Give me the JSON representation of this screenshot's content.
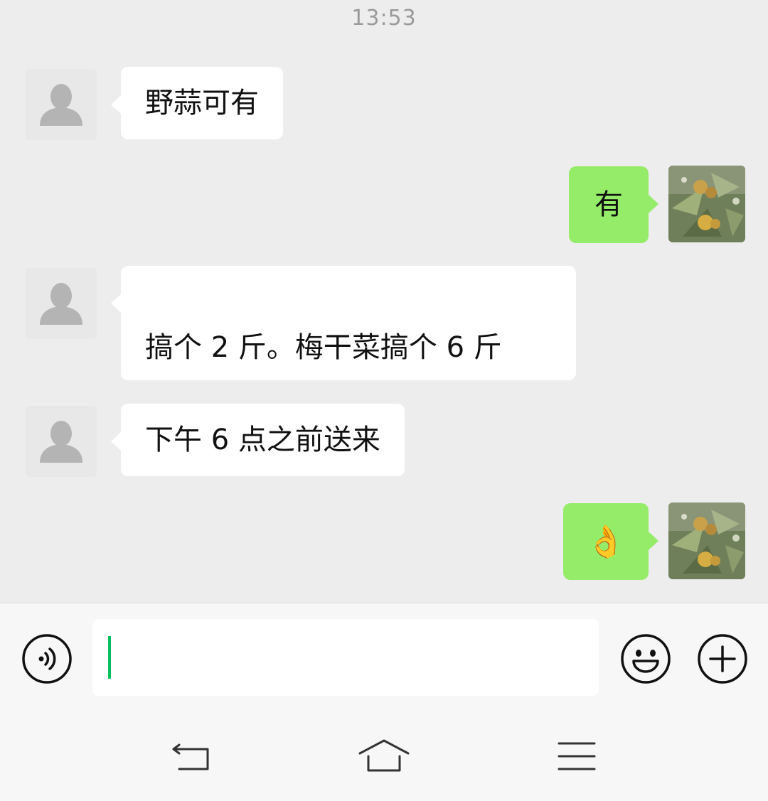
{
  "status": {
    "time": "13:53"
  },
  "messages": [
    {
      "side": "in",
      "text": "野蒜可有"
    },
    {
      "side": "out",
      "text": "有"
    },
    {
      "side": "in",
      "line1": "",
      "line2": "搞个 2 斤。梅干菜搞个 6 斤"
    },
    {
      "side": "in",
      "text": "下午 6 点之前送来"
    },
    {
      "side": "out",
      "emoji": "👌"
    }
  ],
  "icons": {
    "voice": "voice-icon",
    "emoji": "emoji-icon",
    "plus": "plus-icon",
    "back": "back-icon",
    "home": "home-icon",
    "menu": "menu-icon",
    "default_avatar": "person-icon"
  },
  "colors": {
    "background": "#ededed",
    "incoming_bubble": "#ffffff",
    "outgoing_bubble": "#95ec69",
    "caret": "#07c160"
  }
}
